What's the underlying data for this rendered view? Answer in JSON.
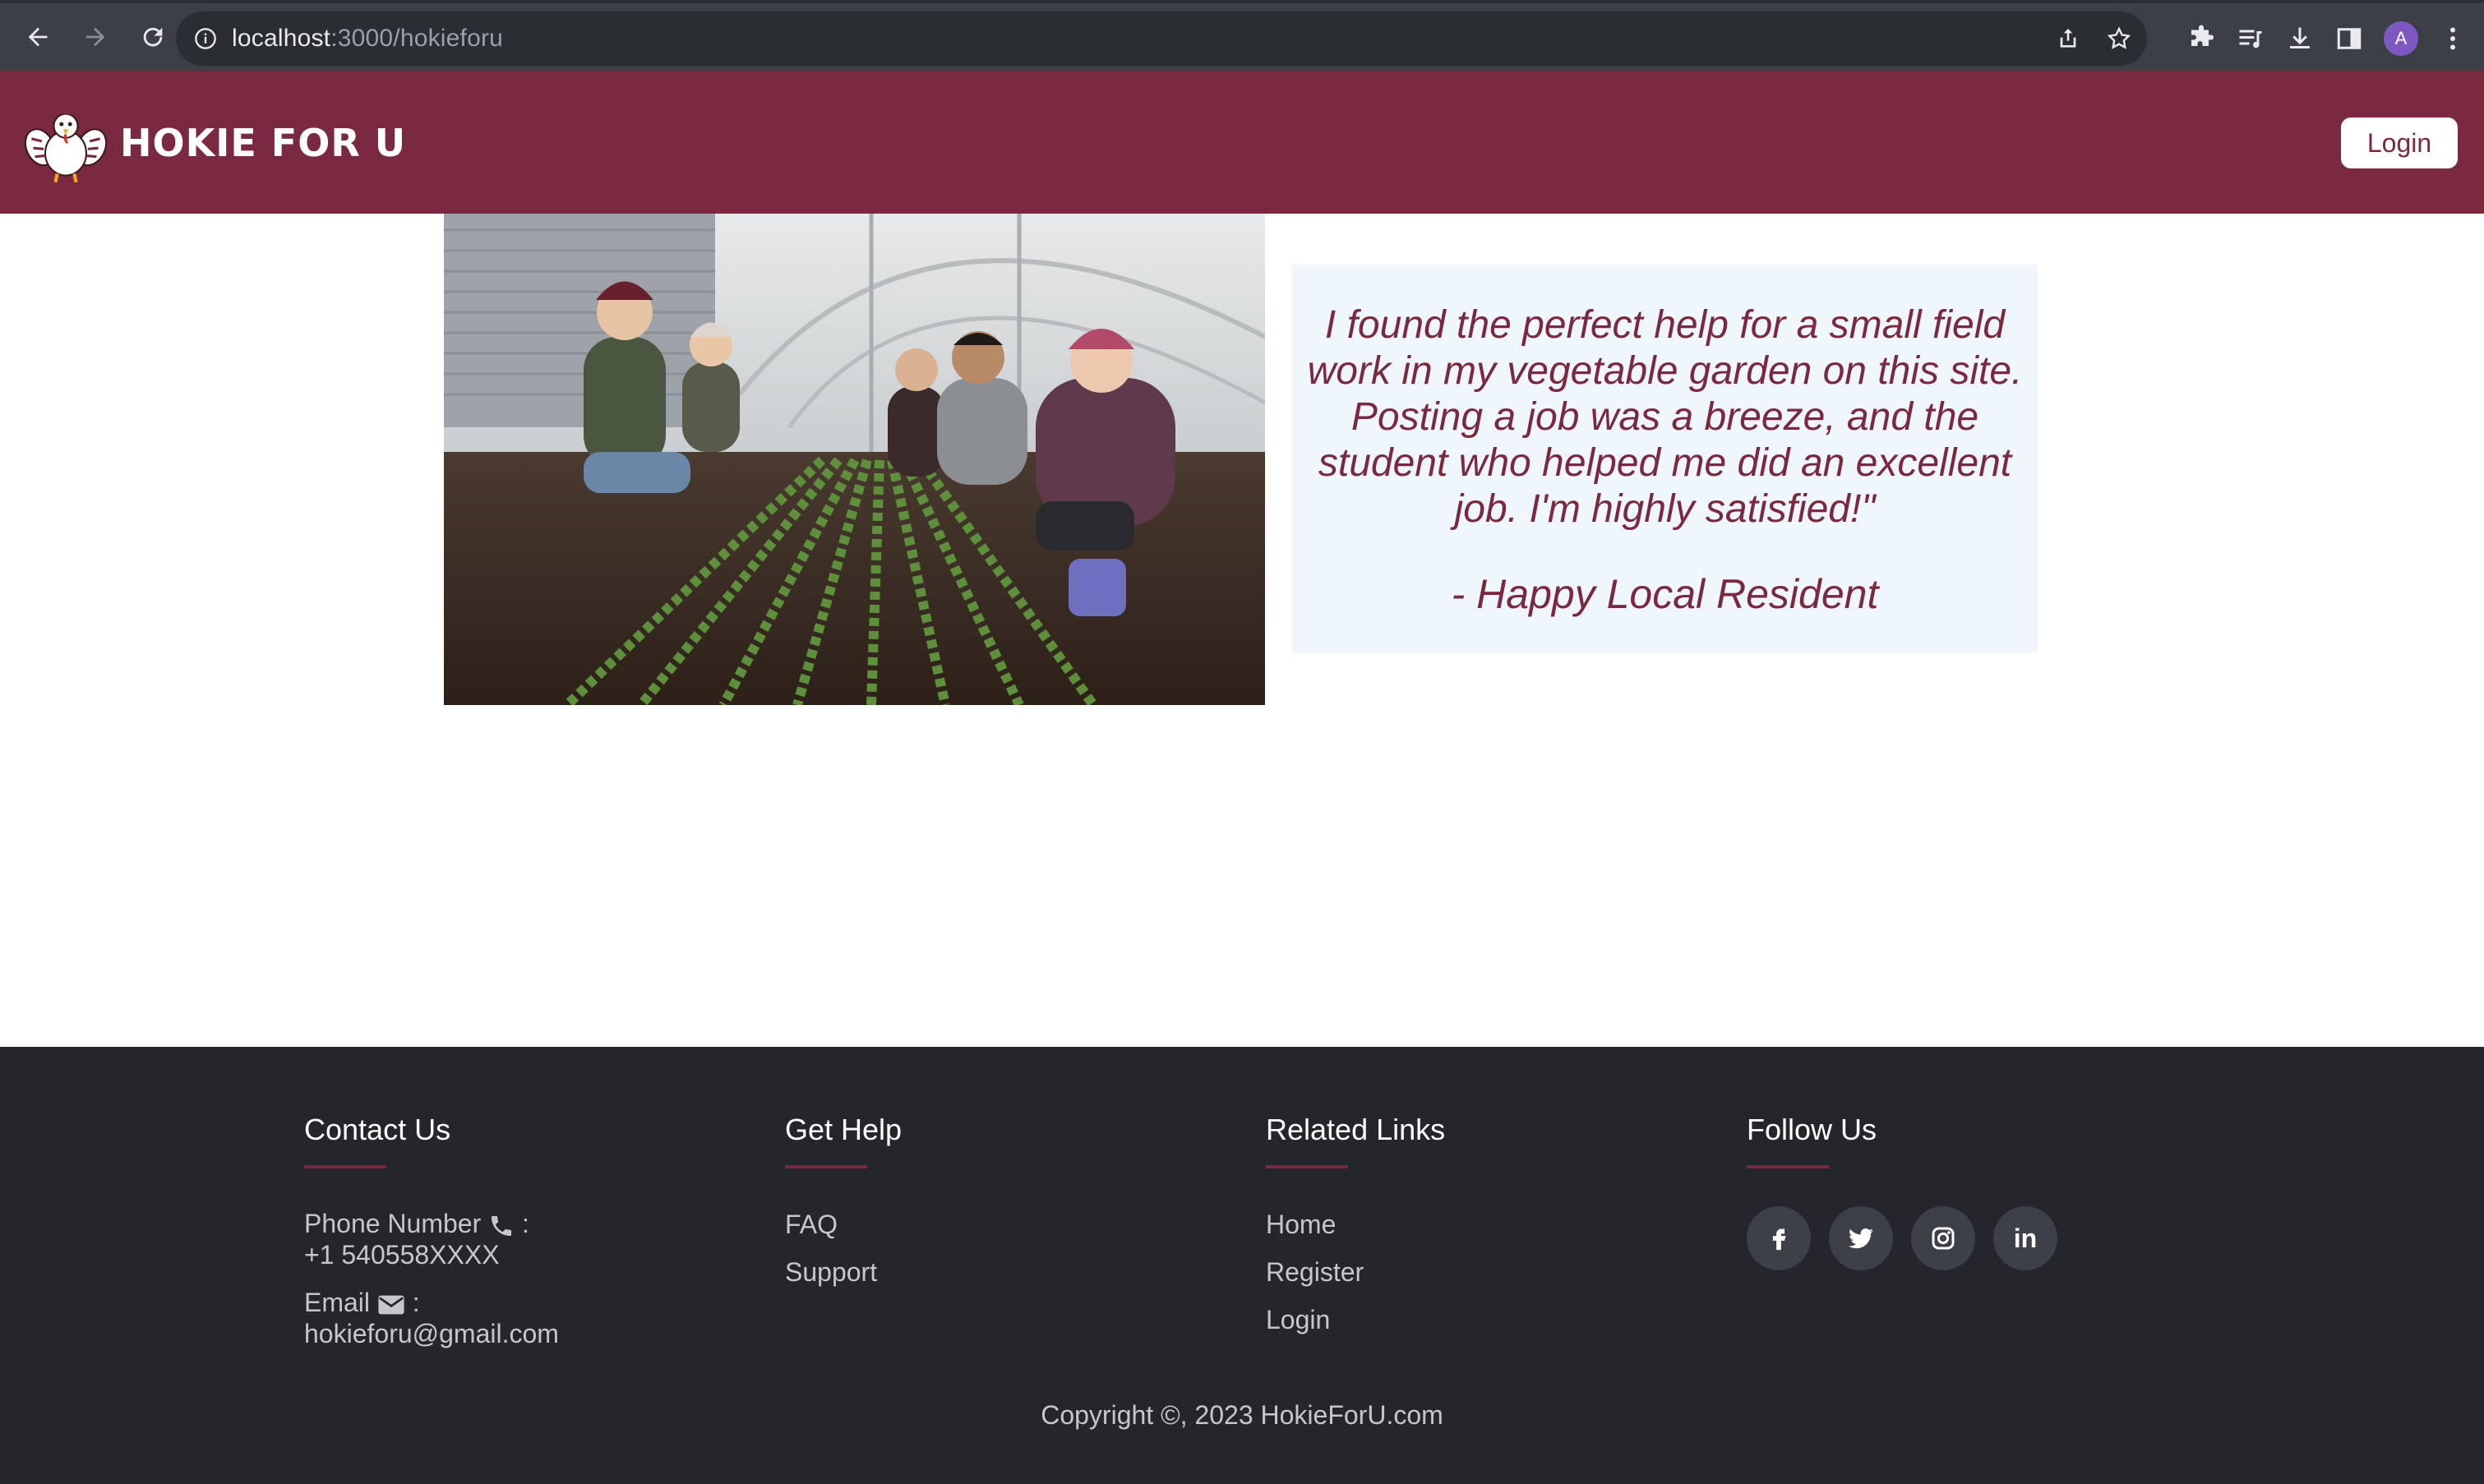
{
  "browser": {
    "url_host": "localhost",
    "url_rest": ":3000/hokieforu",
    "profile_initial": "A"
  },
  "header": {
    "brand_name": "HOKIE FOR U",
    "login_label": "Login"
  },
  "testimonial": {
    "quote": "I found the perfect help for a small field work in my vegetable garden on this site. Posting a job was a breeze, and the student who helped me did an excellent job. I'm highly satisfied!\"",
    "author": "- Happy Local Resident"
  },
  "footer": {
    "contact": {
      "heading": "Contact Us",
      "phone_label": "Phone Number",
      "phone_value": "+1 540558XXXX",
      "email_label": "Email",
      "email_value": "hokieforu@gmail.com",
      "separator": ":"
    },
    "help": {
      "heading": "Get Help",
      "links": [
        "FAQ",
        "Support"
      ]
    },
    "related": {
      "heading": "Related Links",
      "links": [
        "Home",
        "Register",
        "Login"
      ]
    },
    "follow": {
      "heading": "Follow Us",
      "networks": [
        "facebook",
        "twitter",
        "instagram",
        "linkedin"
      ],
      "linkedin_text": "in"
    },
    "copyright": "Copyright ©, 2023 HokieForU.com"
  },
  "colors": {
    "brand_maroon": "#7b2940",
    "footer_bg": "#24262b",
    "testimonial_bg": "#eff6fc"
  }
}
